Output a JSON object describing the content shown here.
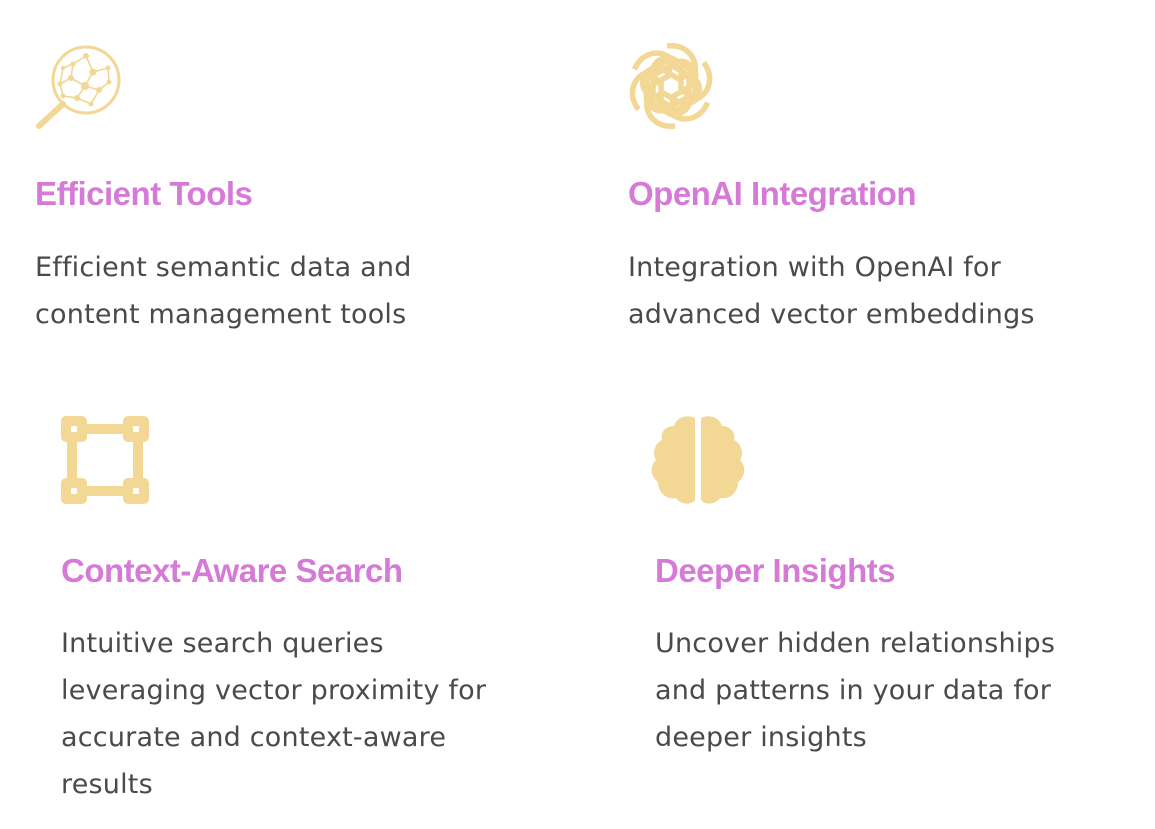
{
  "colors": {
    "accent_title": "#d57ad6",
    "icon": "#f2d795",
    "text": "#4a4a4a",
    "background": "#ffffff"
  },
  "features": [
    {
      "icon": "magnifier-network-icon",
      "title": "Efficient Tools",
      "description_lines": [
        "Efficient semantic data and",
        "content management tools"
      ]
    },
    {
      "icon": "openai-logo-icon",
      "title": "OpenAI Integration",
      "description_lines": [
        "Integration with OpenAI for",
        "advanced vector embeddings"
      ]
    },
    {
      "icon": "vector-square-icon",
      "title": "Context-Aware Search",
      "description_lines": [
        "Intuitive search queries",
        "leveraging vector proximity for",
        "accurate and context-aware",
        "results"
      ]
    },
    {
      "icon": "brain-icon",
      "title": "Deeper Insights",
      "description_lines": [
        "Uncover hidden relationships",
        "and patterns in your data for",
        "deeper insights"
      ]
    }
  ]
}
